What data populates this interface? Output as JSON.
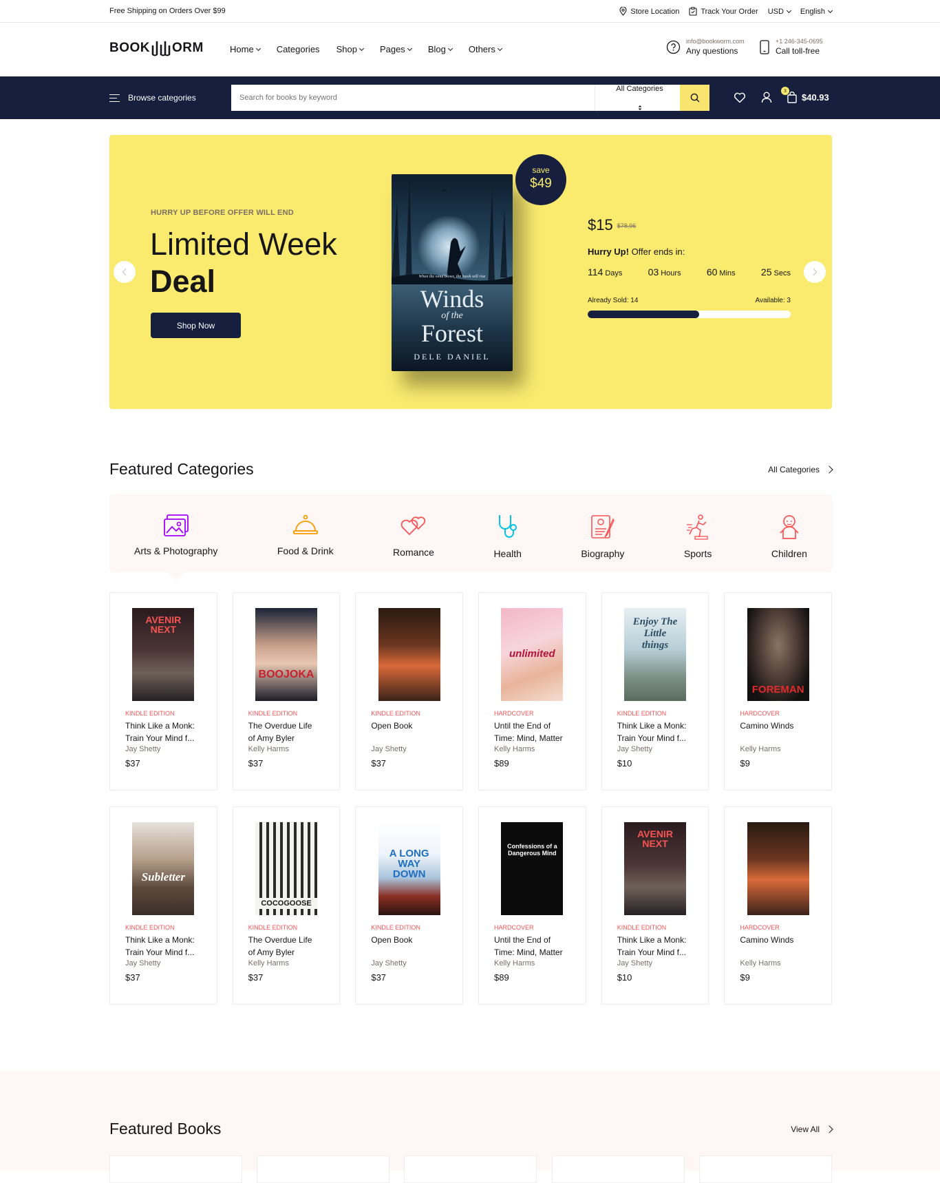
{
  "topbar": {
    "shipping": "Free Shipping on Orders Over $99",
    "store_location": "Store Location",
    "track_order": "Track Your Order",
    "currency": "USD",
    "language": "English"
  },
  "header": {
    "logo_left": "BOOK",
    "logo_right": "ORM",
    "nav": [
      "Home",
      "Categories",
      "Shop",
      "Pages",
      "Blog",
      "Others"
    ],
    "email": "info@bookworm.com",
    "questions": "Any questions",
    "phone": "+1 246-345-0695",
    "call": "Call toll-free"
  },
  "bar": {
    "browse": "Browse categories",
    "search_placeholder": "Search for books by keyword",
    "category_select": "All Categories",
    "cart_count": "3",
    "cart_total": "$40.93"
  },
  "hero": {
    "eyebrow": "HURRY UP BEFORE OFFER WILL END",
    "title_line1": "Limited Week",
    "title_line2": "Deal",
    "cta": "Shop Now",
    "save_label": "save",
    "save_value": "$49",
    "book_tagline": "When the wind blows, the hawk will rise",
    "book_title1": "Winds",
    "book_title2": "of the",
    "book_title3": "Forest",
    "book_author": "DELE DANIEL",
    "price": "$15",
    "old_price": "$78,96",
    "offer_bold": "Hurry Up!",
    "offer_rest": " Offer ends in:",
    "timer": [
      {
        "n": "114",
        "u": "Days"
      },
      {
        "n": "03",
        "u": "Hours"
      },
      {
        "n": "60",
        "u": "Mins"
      },
      {
        "n": "25",
        "u": "Secs"
      }
    ],
    "sold": "Already Sold: 14",
    "available": "Available: 3",
    "sold_fraction": 0.55
  },
  "featured_categories": {
    "title": "Featured Categories",
    "link": "All Categories",
    "items": [
      {
        "label": "Arts & Photography",
        "icon": "image-icon",
        "color": "#a200fc"
      },
      {
        "label": "Food & Drink",
        "icon": "cloche-icon",
        "color": "#f99b00"
      },
      {
        "label": "Romance",
        "icon": "hearts-icon",
        "color": "#f75454"
      },
      {
        "label": "Health",
        "icon": "stethoscope-icon",
        "color": "#01c5e6"
      },
      {
        "label": "Biography",
        "icon": "document-icon",
        "color": "#f75454"
      },
      {
        "label": "Sports",
        "icon": "runner-icon",
        "color": "#f75454"
      },
      {
        "label": "Children",
        "icon": "baby-icon",
        "color": "#f75454"
      }
    ]
  },
  "products_row1": [
    {
      "format": "KINDLE EDITION",
      "name1": "Think Like a Monk:",
      "name2": "Train Your Mind f...",
      "author": "Jay Shetty",
      "price": "$37",
      "cover_text": "AVENIR NEXT"
    },
    {
      "format": "KINDLE EDITION",
      "name1": "The Overdue Life",
      "name2": "of Amy Byler",
      "author": "Kelly Harms",
      "price": "$37",
      "cover_text": "BOOJOKA"
    },
    {
      "format": "KINDLE EDITION",
      "name1": "Open Book",
      "name2": "",
      "author": "Jay Shetty",
      "price": "$37",
      "cover_text": ""
    },
    {
      "format": "HARDCOVER",
      "name1": "Until the End of",
      "name2": "Time: Mind, Matter",
      "author": "Kelly Harms",
      "price": "$89",
      "cover_text": "unlimited"
    },
    {
      "format": "KINDLE EDITION",
      "name1": "Think Like a Monk:",
      "name2": "Train Your Mind f...",
      "author": "Jay Shetty",
      "price": "$10",
      "cover_text": "Enjoy The Little things"
    },
    {
      "format": "HARDCOVER",
      "name1": "Camino Winds",
      "name2": "",
      "author": "Kelly Harms",
      "price": "$9",
      "cover_text": "FOREMAN"
    }
  ],
  "products_row2": [
    {
      "format": "KINDLE EDITION",
      "name1": "Think Like a Monk:",
      "name2": "Train Your Mind f...",
      "author": "Jay Shetty",
      "price": "$37",
      "cover_text": "Subletter"
    },
    {
      "format": "KINDLE EDITION",
      "name1": "The Overdue Life",
      "name2": "of Amy Byler",
      "author": "Kelly Harms",
      "price": "$37",
      "cover_text": "COCOGOOSE"
    },
    {
      "format": "KINDLE EDITION",
      "name1": "Open Book",
      "name2": "",
      "author": "Jay Shetty",
      "price": "$37",
      "cover_text": "A LONG WAY DOWN"
    },
    {
      "format": "HARDCOVER",
      "name1": "Until the End of",
      "name2": "Time: Mind, Matter",
      "author": "Kelly Harms",
      "price": "$89",
      "cover_text": "Confessions of a Dangerous Mind"
    },
    {
      "format": "KINDLE EDITION",
      "name1": "Think Like a Monk:",
      "name2": "Train Your Mind f...",
      "author": "Jay Shetty",
      "price": "$10",
      "cover_text": "AVENIR NEXT"
    },
    {
      "format": "HARDCOVER",
      "name1": "Camino Winds",
      "name2": "",
      "author": "Kelly Harms",
      "price": "$9",
      "cover_text": ""
    }
  ],
  "featured_books": {
    "title": "Featured Books",
    "link": "View All"
  },
  "colors": {
    "navy": "#161f3e",
    "yellow": "#faeb6e",
    "accent_red": "#f75454",
    "pink_bg": "#fff6f6"
  }
}
